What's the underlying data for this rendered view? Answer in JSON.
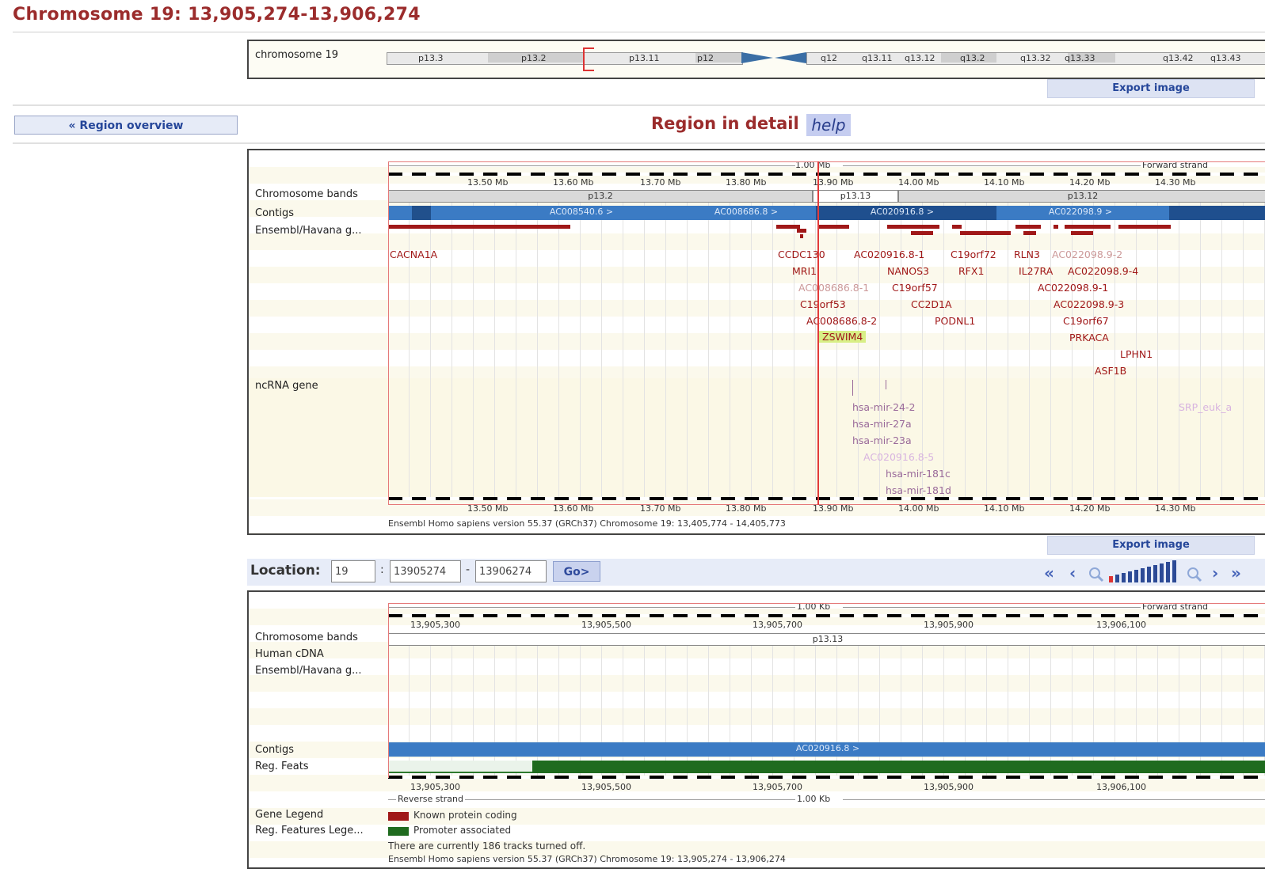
{
  "page_title": "Chromosome 19: 13,905,274-13,906,274",
  "overview": {
    "label": "chromosome 19",
    "bands": [
      "p13.3",
      "p13.2",
      "p13.11",
      "p12",
      "q12",
      "q13.11",
      "q13.12",
      "q13.2",
      "q13.32",
      "q13.33",
      "q13.42",
      "q13.43"
    ],
    "export_label": "Export image"
  },
  "nav": {
    "region_overview": "« Region overview"
  },
  "region_detail": {
    "title": "Region in detail",
    "help": "help",
    "scale_label": "1.00 Mb",
    "strand": "Forward strand",
    "ticks": [
      "13.50 Mb",
      "13.60 Mb",
      "13.70 Mb",
      "13.80 Mb",
      "13.90 Mb",
      "14.00 Mb",
      "14.10 Mb",
      "14.20 Mb",
      "14.30 Mb"
    ],
    "tracks": [
      "Chromosome bands",
      "Contigs",
      "Ensembl/Havana g...",
      "ncRNA gene"
    ],
    "bands": [
      "p13.2",
      "p13.13",
      "p13.12"
    ],
    "contigs": [
      "AC008540.6 >",
      "AC008686.8 >",
      "AC020916.8 >",
      "AC022098.9 >"
    ],
    "genes": [
      "CACNA1A",
      "CCDC130",
      "MRI1",
      "AC008686.8-1",
      "C19orf53",
      "AC008686.8-2",
      "ZSWIM4",
      "AC020916.8-1",
      "NANOS3",
      "C19orf57",
      "CC2D1A",
      "PODNL1",
      "C19orf72",
      "RFX1",
      "RLN3",
      "AC022098.9-2",
      "IL27RA",
      "AC022098.9-4",
      "AC022098.9-1",
      "AC022098.9-3",
      "C19orf67",
      "PRKACA",
      "LPHN1",
      "ASF1B"
    ],
    "ncrna": [
      "hsa-mir-24-2",
      "hsa-mir-27a",
      "hsa-mir-23a",
      "AC020916.8-5",
      "hsa-mir-181c",
      "hsa-mir-181d",
      "SRP_euk_a"
    ],
    "footer": "Ensembl Homo sapiens version 55.37 (GRCh37) Chromosome 19: 13,405,774 - 14,405,773",
    "export_label": "Export image"
  },
  "location": {
    "label": "Location:",
    "chr": "19",
    "sep1": ":",
    "start": "13905274",
    "sep2": "-",
    "end": "13906274",
    "go": "Go>"
  },
  "view_detail": {
    "scale_label": "1.00 Kb",
    "strand_fwd": "Forward strand",
    "strand_rev": "Reverse strand",
    "ticks": [
      "13,905,300",
      "13,905,500",
      "13,905,700",
      "13,905,900",
      "13,906,100"
    ],
    "tracks": [
      "Chromosome bands",
      "Human cDNA",
      "Ensembl/Havana g...",
      "Contigs",
      "Reg. Feats",
      "Gene Legend",
      "Reg. Features Lege..."
    ],
    "band": "p13.13",
    "contig": "AC020916.8 >",
    "legend_gene": "Known protein coding",
    "legend_reg": "Promoter associated",
    "tracks_off": "There are currently 186 tracks turned off.",
    "footer": "Ensembl Homo sapiens version 55.37 (GRCh37) Chromosome 19: 13,905,274 - 13,906,274"
  },
  "colors": {
    "accent": "#9b2c2c",
    "link": "#26479a",
    "gene": "#a01818",
    "contig": "#3b7bc4",
    "reg": "#1f6b1f"
  }
}
